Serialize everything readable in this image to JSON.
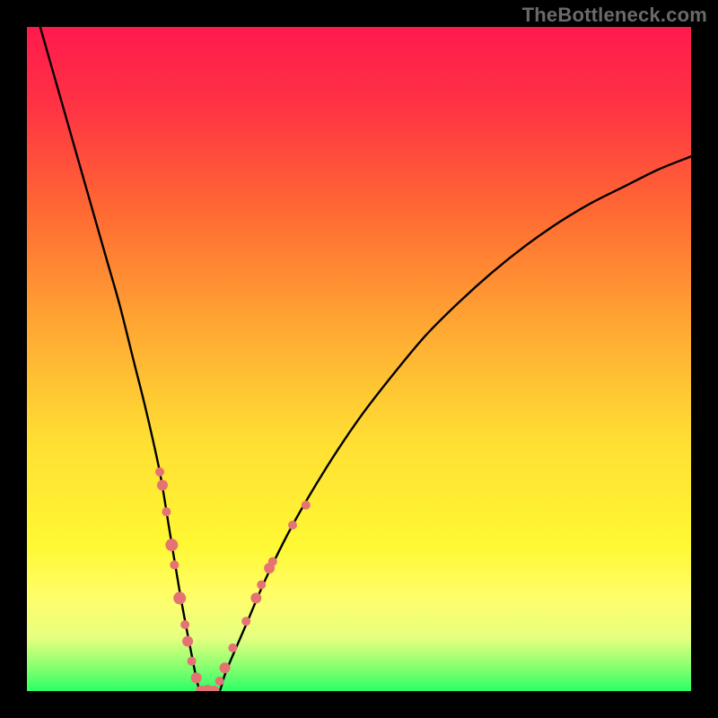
{
  "watermark": "TheBottleneck.com",
  "colors": {
    "frame": "#000000",
    "curve": "#000000",
    "point_fill": "#e57373",
    "gradient_stops": [
      {
        "offset": 0.0,
        "color": "#ff1a4d"
      },
      {
        "offset": 0.12,
        "color": "#ff3344"
      },
      {
        "offset": 0.28,
        "color": "#ff6a33"
      },
      {
        "offset": 0.45,
        "color": "#ffa733"
      },
      {
        "offset": 0.62,
        "color": "#ffde33"
      },
      {
        "offset": 0.78,
        "color": "#fff833"
      },
      {
        "offset": 0.86,
        "color": "#fffe6b"
      },
      {
        "offset": 0.92,
        "color": "#e6ff80"
      },
      {
        "offset": 0.96,
        "color": "#90ff70"
      },
      {
        "offset": 1.0,
        "color": "#2cff66"
      }
    ]
  },
  "chart_data": {
    "type": "line",
    "title": "",
    "xlabel": "",
    "ylabel": "",
    "x_range": [
      0,
      100
    ],
    "y_range": [
      0,
      100
    ],
    "series": [
      {
        "name": "curve",
        "x": [
          2,
          4,
          6,
          8,
          10,
          12,
          14,
          16,
          18,
          20,
          21.5,
          23,
          24.5,
          26,
          27,
          28,
          29,
          30,
          33,
          36,
          40,
          45,
          50,
          55,
          60,
          65,
          70,
          75,
          80,
          85,
          90,
          95,
          100
        ],
        "y": [
          100,
          93,
          86,
          79,
          72,
          65,
          58,
          50,
          42,
          33,
          24,
          15,
          7,
          0,
          0,
          0,
          0,
          3,
          10,
          17,
          25,
          33.5,
          41,
          47.5,
          53.5,
          58.5,
          63,
          67,
          70.5,
          73.5,
          76,
          78.5,
          80.5
        ]
      }
    ],
    "points": [
      {
        "x": 20.0,
        "y": 33.0,
        "r": 5
      },
      {
        "x": 20.4,
        "y": 31.0,
        "r": 6
      },
      {
        "x": 21.0,
        "y": 27.0,
        "r": 5
      },
      {
        "x": 21.8,
        "y": 22.0,
        "r": 7
      },
      {
        "x": 22.2,
        "y": 19.0,
        "r": 5
      },
      {
        "x": 23.0,
        "y": 14.0,
        "r": 7
      },
      {
        "x": 23.8,
        "y": 10.0,
        "r": 5
      },
      {
        "x": 24.2,
        "y": 7.5,
        "r": 6
      },
      {
        "x": 24.8,
        "y": 4.5,
        "r": 5
      },
      {
        "x": 25.5,
        "y": 2.0,
        "r": 6
      },
      {
        "x": 26.2,
        "y": 0.0,
        "r": 6
      },
      {
        "x": 27.2,
        "y": 0.0,
        "r": 7
      },
      {
        "x": 28.2,
        "y": 0.0,
        "r": 6
      },
      {
        "x": 29.0,
        "y": 1.5,
        "r": 5
      },
      {
        "x": 29.8,
        "y": 3.5,
        "r": 6
      },
      {
        "x": 31.0,
        "y": 6.5,
        "r": 5
      },
      {
        "x": 33.0,
        "y": 10.5,
        "r": 5
      },
      {
        "x": 34.5,
        "y": 14.0,
        "r": 6
      },
      {
        "x": 35.3,
        "y": 16.0,
        "r": 5
      },
      {
        "x": 36.5,
        "y": 18.5,
        "r": 6
      },
      {
        "x": 37.0,
        "y": 19.5,
        "r": 5
      },
      {
        "x": 40.0,
        "y": 25.0,
        "r": 5
      },
      {
        "x": 42.0,
        "y": 28.0,
        "r": 5
      }
    ]
  }
}
